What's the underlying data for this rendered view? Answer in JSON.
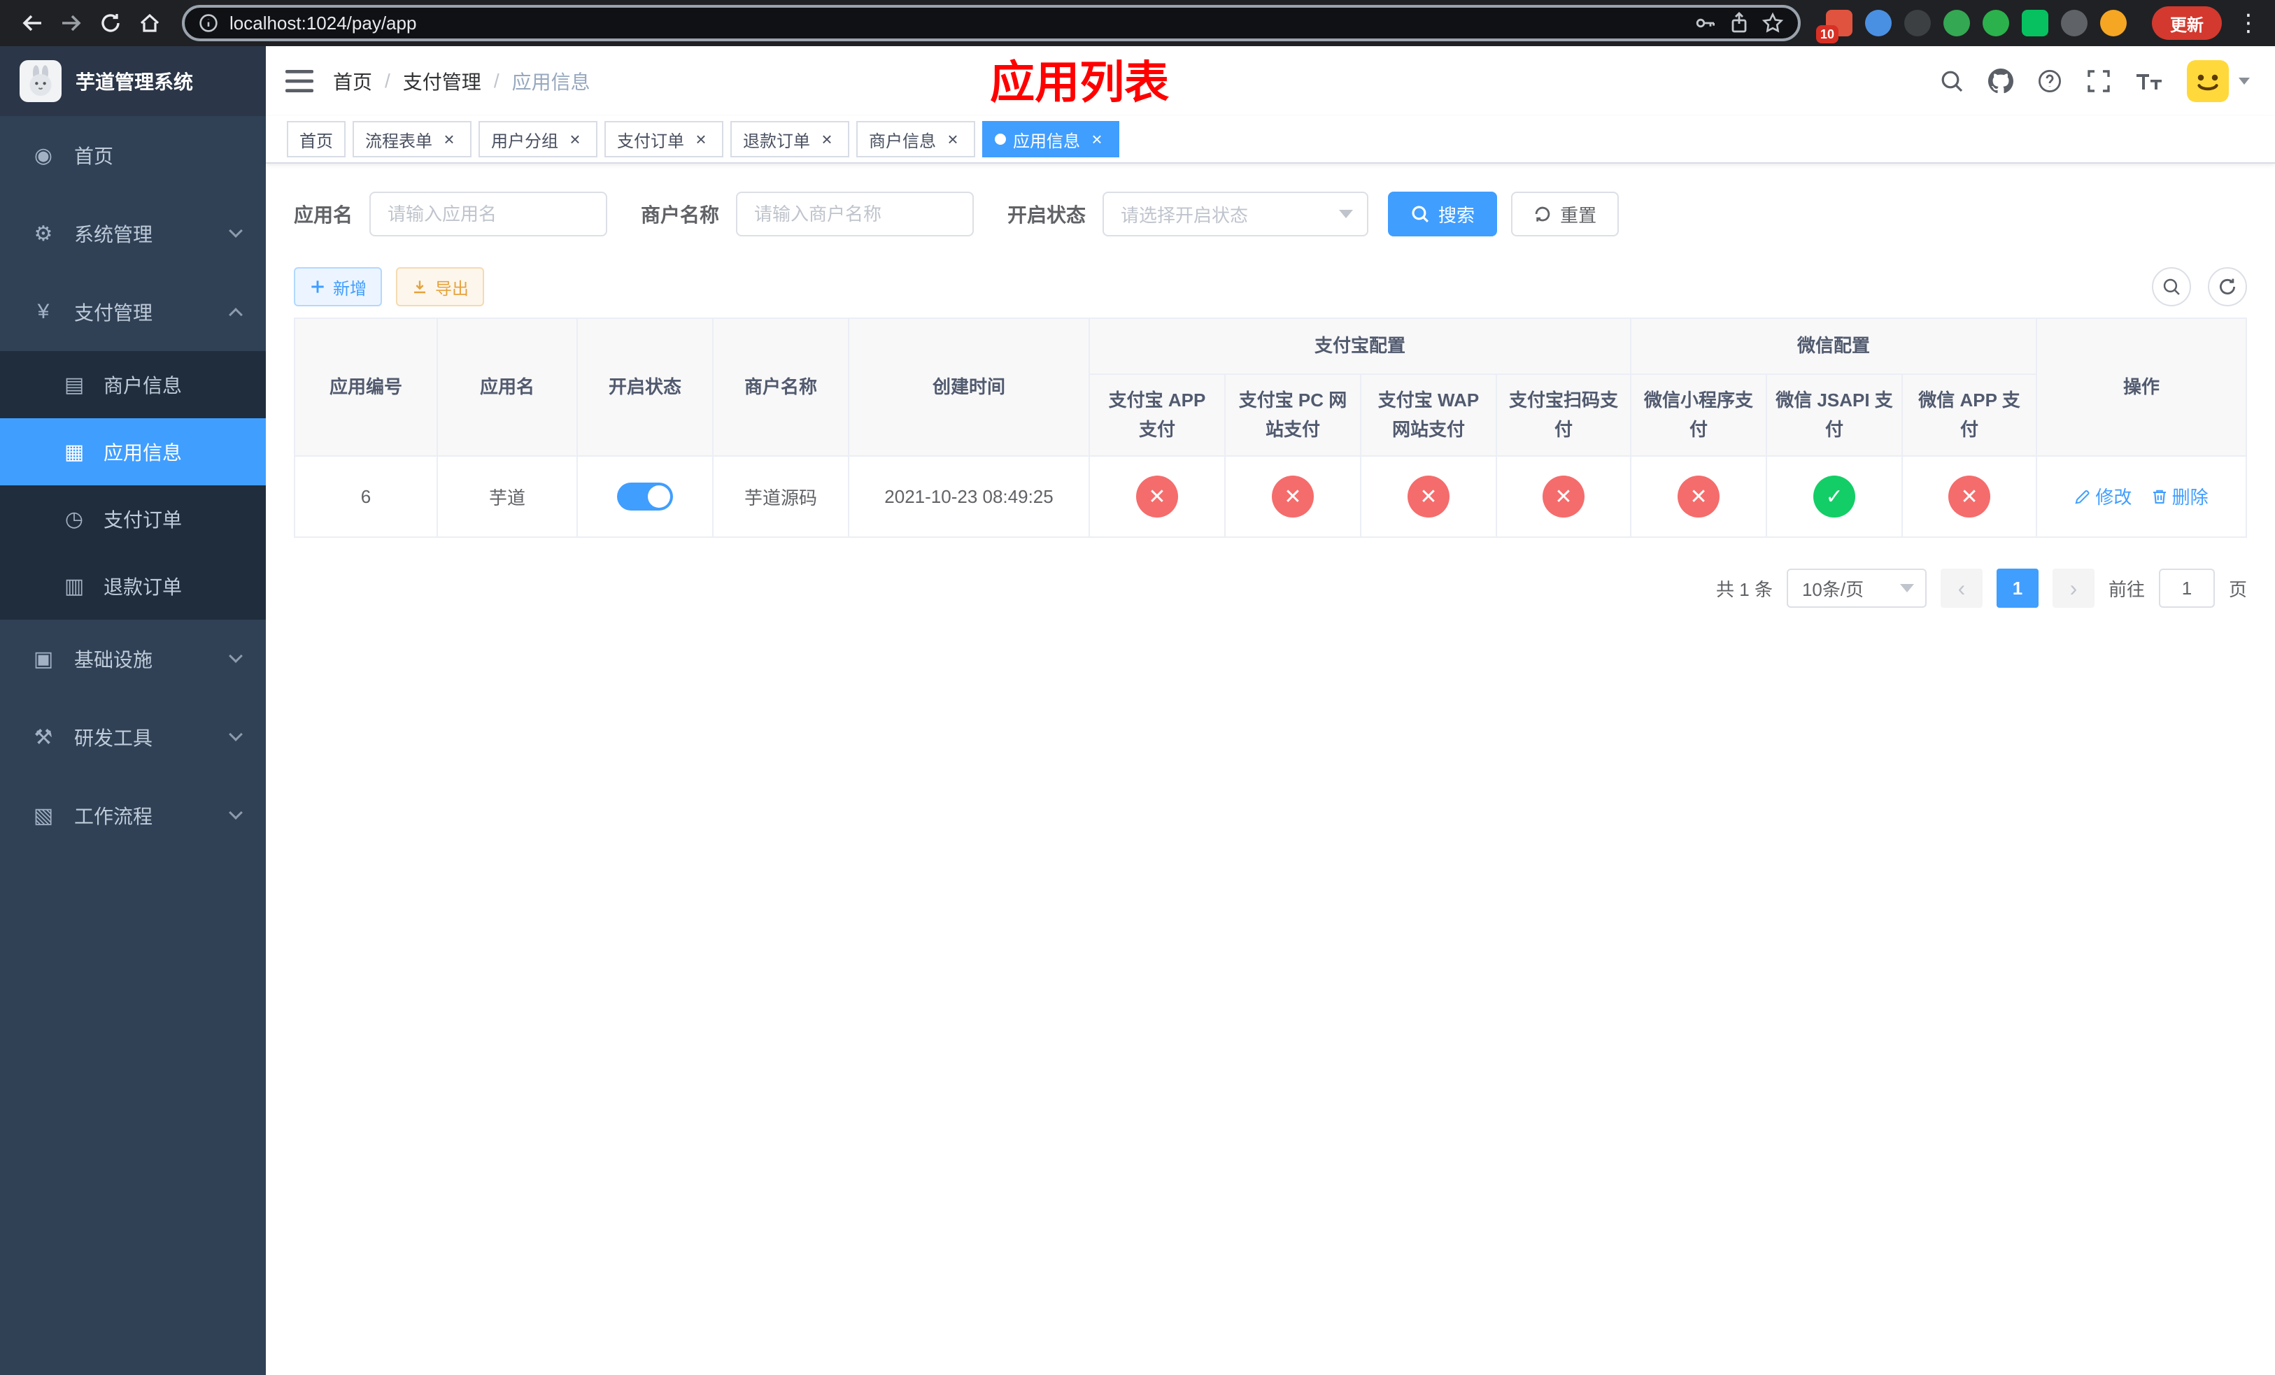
{
  "icons": {
    "close": "×",
    "breadcrumb_separator": "/",
    "check": "✓",
    "cross": "✕",
    "ellipsis": "⋮",
    "prev": "‹",
    "next": "›"
  },
  "browser": {
    "url": "localhost:1024/pay/app",
    "update_label": "更新",
    "extension_badge": "10"
  },
  "sidebar": {
    "title": "芋道管理系统",
    "items": [
      {
        "icon": "◉",
        "label": "首页"
      },
      {
        "icon": "⚙",
        "label": "系统管理"
      },
      {
        "icon": "¥",
        "label": "支付管理"
      },
      {
        "icon": "▤",
        "label": "商户信息"
      },
      {
        "icon": "▦",
        "label": "应用信息"
      },
      {
        "icon": "◷",
        "label": "支付订单"
      },
      {
        "icon": "▥",
        "label": "退款订单"
      },
      {
        "icon": "▣",
        "label": "基础设施"
      },
      {
        "icon": "⚒",
        "label": "研发工具"
      },
      {
        "icon": "▧",
        "label": "工作流程"
      }
    ]
  },
  "header": {
    "breadcrumb": [
      {
        "label": "首页"
      },
      {
        "label": "支付管理"
      },
      {
        "label": "应用信息"
      }
    ],
    "title": "应用列表"
  },
  "tabs": [
    {
      "label": "首页"
    },
    {
      "label": "流程表单"
    },
    {
      "label": "用户分组"
    },
    {
      "label": "支付订单"
    },
    {
      "label": "退款订单"
    },
    {
      "label": "商户信息"
    },
    {
      "label": "应用信息"
    }
  ],
  "filters": {
    "app_name_label": "应用名",
    "app_name_placeholder": "请输入应用名",
    "merchant_label": "商户名称",
    "merchant_placeholder": "请输入商户名称",
    "status_label": "开启状态",
    "status_placeholder": "请选择开启状态",
    "search_button": "搜索",
    "reset_button": "重置"
  },
  "toolbar": {
    "add_button": "新增",
    "export_button": "导出"
  },
  "table": {
    "headers": {
      "app_id": "应用编号",
      "app_name": "应用名",
      "status": "开启状态",
      "merchant": "商户名称",
      "created": "创建时间",
      "alipay_group": "支付宝配置",
      "wechat_group": "微信配置",
      "alipay_app": "支付宝 APP 支付",
      "alipay_pc": "支付宝 PC 网站支付",
      "alipay_wap": "支付宝 WAP 网站支付",
      "alipay_qr": "支付宝扫码支付",
      "wx_mini": "微信小程序支付",
      "wx_jsapi": "微信 JSAPI 支付",
      "wx_app": "微信 APP 支付",
      "actions": "操作"
    },
    "rows": [
      {
        "app_id": "6",
        "app_name": "芋道",
        "enabled": true,
        "merchant": "芋道源码",
        "created": "2021-10-23 08:49:25",
        "alipay_app": false,
        "alipay_pc": false,
        "alipay_wap": false,
        "alipay_qr": false,
        "wx_mini": false,
        "wx_jsapi": true,
        "wx_app": false,
        "edit_label": "修改",
        "delete_label": "删除"
      }
    ]
  },
  "pagination": {
    "total": "共 1 条",
    "page_size": "10条/页",
    "page": "1",
    "goto_prefix": "前往",
    "goto_value": "1",
    "goto_suffix": "页"
  }
}
